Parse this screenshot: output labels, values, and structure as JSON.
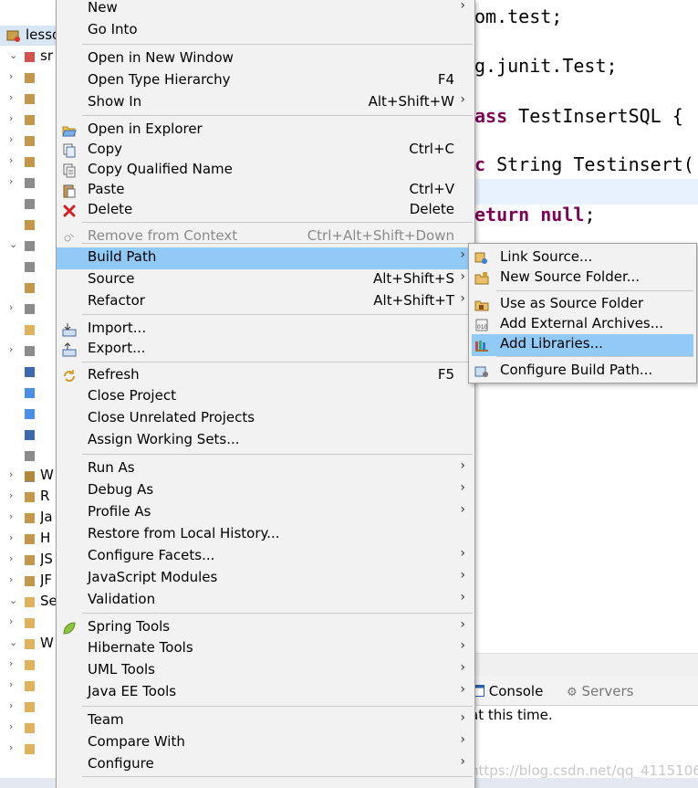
{
  "explorer": {
    "project_label": "lesso",
    "rows": [
      {
        "chev": "⌄",
        "label": "sr"
      },
      {
        "chev": "›",
        "label": ""
      },
      {
        "chev": "›",
        "label": ""
      },
      {
        "chev": "›",
        "label": ""
      },
      {
        "chev": "›",
        "label": ""
      },
      {
        "chev": "›",
        "label": ""
      },
      {
        "chev": "›",
        "label": ""
      },
      {
        "chev": "",
        "label": ""
      },
      {
        "chev": "",
        "label": ""
      },
      {
        "chev": "⌄",
        "label": ""
      },
      {
        "chev": "",
        "label": ""
      },
      {
        "chev": "",
        "label": ""
      },
      {
        "chev": "›",
        "label": ""
      },
      {
        "chev": "",
        "label": ""
      },
      {
        "chev": "›",
        "label": ""
      },
      {
        "chev": "",
        "label": ""
      },
      {
        "chev": "",
        "label": ""
      },
      {
        "chev": "",
        "label": ""
      },
      {
        "chev": "",
        "label": ""
      },
      {
        "chev": "",
        "label": ""
      },
      {
        "chev": "",
        "label": ""
      },
      {
        "chev": "›",
        "label": "W"
      },
      {
        "chev": "›",
        "label": "R"
      },
      {
        "chev": "›",
        "label": "Ja"
      },
      {
        "chev": "›",
        "label": "H"
      },
      {
        "chev": "›",
        "label": "JS"
      },
      {
        "chev": "›",
        "label": "JF"
      },
      {
        "chev": "⌄",
        "label": "Se"
      },
      {
        "chev": "›",
        "label": ""
      },
      {
        "chev": "⌄",
        "label": "W"
      },
      {
        "chev": "›",
        "label": ""
      },
      {
        "chev": "›",
        "label": ""
      },
      {
        "chev": "›",
        "label": ""
      },
      {
        "chev": "›",
        "label": ""
      },
      {
        "chev": "›",
        "label": ""
      }
    ]
  },
  "editor": {
    "line1": "om.test;",
    "line2": "g.junit.Test;",
    "line3_kw": "ass",
    "line3_rest": " TestInsertSQL {",
    "line4_kw": "c",
    "line4_rest": " String Testinsert(",
    "line5_kw1": "eturn",
    "line5_kw2": "null",
    "line5_end": ";"
  },
  "console": {
    "tab_console": "Console",
    "tab_servers": "Servers",
    "message": "at this time.",
    "watermark": "https://blog.csdn.net/qq_41151066"
  },
  "context_menu": {
    "items": [
      {
        "label": "New",
        "shortcut": "",
        "submenu": true,
        "icon": ""
      },
      {
        "label": "Go Into",
        "shortcut": "",
        "submenu": false,
        "icon": ""
      },
      {
        "label": "Open in New Window",
        "shortcut": "",
        "submenu": false,
        "icon": ""
      },
      {
        "label": "Open Type Hierarchy",
        "shortcut": "F4",
        "submenu": false,
        "icon": ""
      },
      {
        "label": "Show In",
        "shortcut": "Alt+Shift+W",
        "submenu": true,
        "icon": ""
      },
      {
        "label": "Open in Explorer",
        "shortcut": "",
        "submenu": false,
        "icon": "open-folder-icon"
      },
      {
        "label": "Copy",
        "shortcut": "Ctrl+C",
        "submenu": false,
        "icon": "copy-icon"
      },
      {
        "label": "Copy Qualified Name",
        "shortcut": "",
        "submenu": false,
        "icon": "copy-qualified-icon"
      },
      {
        "label": "Paste",
        "shortcut": "Ctrl+V",
        "submenu": false,
        "icon": "paste-icon"
      },
      {
        "label": "Delete",
        "shortcut": "Delete",
        "submenu": false,
        "icon": "delete-icon"
      },
      {
        "label": "Remove from Context",
        "shortcut": "Ctrl+Alt+Shift+Down",
        "submenu": false,
        "icon": "remove-context-icon",
        "disabled": true
      },
      {
        "label": "Build Path",
        "shortcut": "",
        "submenu": true,
        "icon": "",
        "selected": true
      },
      {
        "label": "Source",
        "shortcut": "Alt+Shift+S",
        "submenu": true,
        "icon": ""
      },
      {
        "label": "Refactor",
        "shortcut": "Alt+Shift+T",
        "submenu": true,
        "icon": ""
      },
      {
        "label": "Import...",
        "shortcut": "",
        "submenu": false,
        "icon": "import-icon"
      },
      {
        "label": "Export...",
        "shortcut": "",
        "submenu": false,
        "icon": "export-icon"
      },
      {
        "label": "Refresh",
        "shortcut": "F5",
        "submenu": false,
        "icon": "refresh-icon"
      },
      {
        "label": "Close Project",
        "shortcut": "",
        "submenu": false,
        "icon": ""
      },
      {
        "label": "Close Unrelated Projects",
        "shortcut": "",
        "submenu": false,
        "icon": ""
      },
      {
        "label": "Assign Working Sets...",
        "shortcut": "",
        "submenu": false,
        "icon": ""
      },
      {
        "label": "Run As",
        "shortcut": "",
        "submenu": true,
        "icon": ""
      },
      {
        "label": "Debug As",
        "shortcut": "",
        "submenu": true,
        "icon": ""
      },
      {
        "label": "Profile As",
        "shortcut": "",
        "submenu": true,
        "icon": ""
      },
      {
        "label": "Restore from Local History...",
        "shortcut": "",
        "submenu": false,
        "icon": ""
      },
      {
        "label": "Configure Facets...",
        "shortcut": "",
        "submenu": true,
        "icon": ""
      },
      {
        "label": "JavaScript Modules",
        "shortcut": "",
        "submenu": true,
        "icon": ""
      },
      {
        "label": "Validation",
        "shortcut": "",
        "submenu": true,
        "icon": ""
      },
      {
        "label": "Spring Tools",
        "shortcut": "",
        "submenu": true,
        "icon": "spring-leaf-icon"
      },
      {
        "label": "Hibernate Tools",
        "shortcut": "",
        "submenu": true,
        "icon": ""
      },
      {
        "label": "UML Tools",
        "shortcut": "",
        "submenu": true,
        "icon": ""
      },
      {
        "label": "Java EE Tools",
        "shortcut": "",
        "submenu": true,
        "icon": ""
      },
      {
        "label": "Team",
        "shortcut": "",
        "submenu": true,
        "icon": ""
      },
      {
        "label": "Compare With",
        "shortcut": "",
        "submenu": true,
        "icon": ""
      },
      {
        "label": "Configure",
        "shortcut": "",
        "submenu": true,
        "icon": ""
      }
    ]
  },
  "build_path_submenu": {
    "items": [
      {
        "label": "Link Source...",
        "icon": "link-source-icon"
      },
      {
        "label": "New Source Folder...",
        "icon": "new-source-folder-icon"
      },
      {
        "label": "Use as Source Folder",
        "icon": "use-source-folder-icon"
      },
      {
        "label": "Add External Archives...",
        "icon": "jar-archive-icon"
      },
      {
        "label": "Add Libraries...",
        "icon": "library-icon",
        "selected": true
      },
      {
        "label": "Configure Build Path...",
        "icon": "configure-build-path-icon"
      }
    ]
  },
  "colors": {
    "menu_bg": "#f2f2f2",
    "selection": "#91c9f7",
    "keyword": "#7f0055",
    "disabled": "#8a8a8a"
  }
}
